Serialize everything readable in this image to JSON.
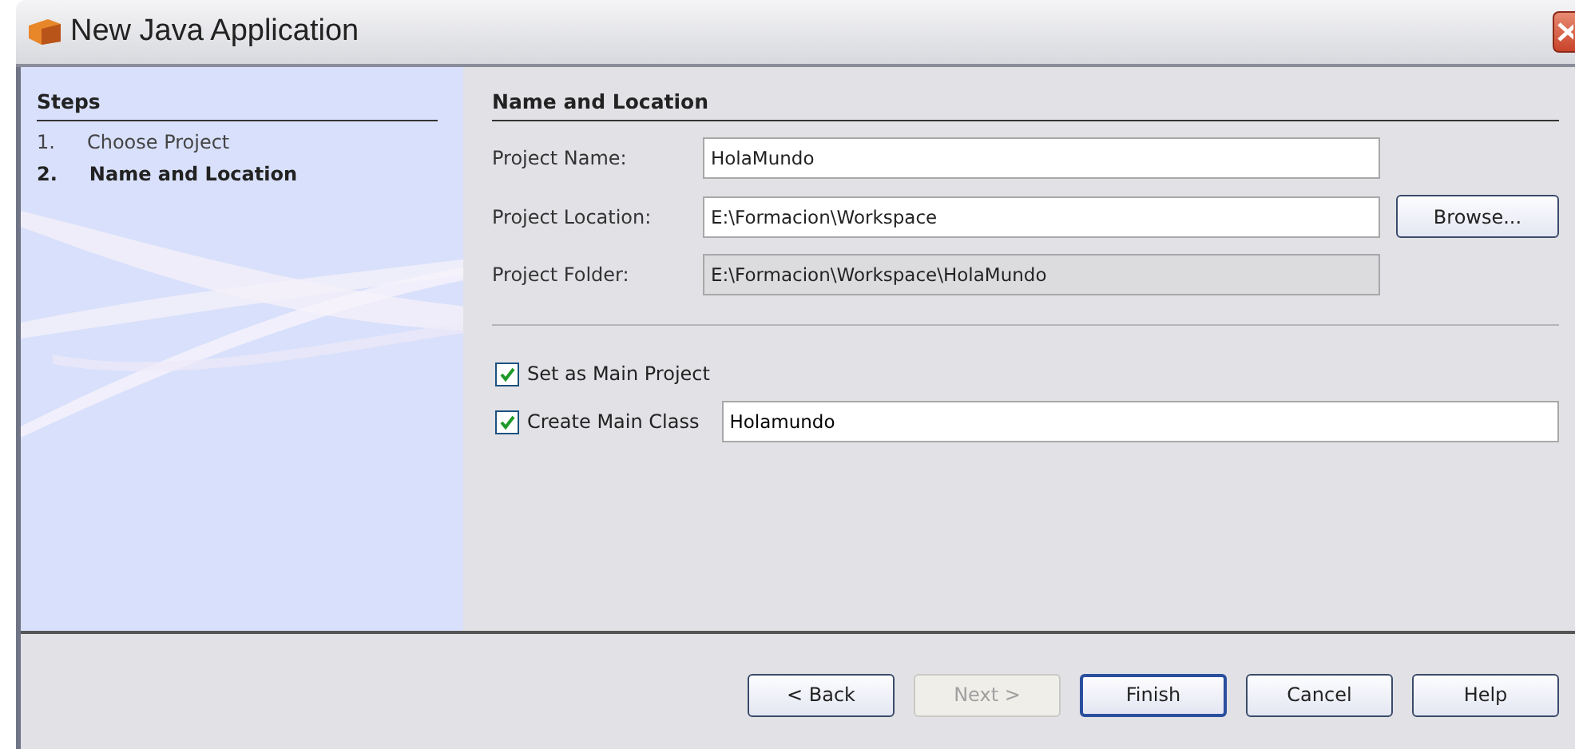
{
  "window": {
    "title": "New Java Application"
  },
  "steps": {
    "title": "Steps",
    "items": [
      {
        "number": "1.",
        "label": "Choose Project",
        "selected": false
      },
      {
        "number": "2.",
        "label": "Name and Location",
        "selected": true
      }
    ]
  },
  "panel": {
    "title": "Name and Location",
    "fields": [
      {
        "label": "Project Name:",
        "value": "HolaMundo",
        "disabled": false
      },
      {
        "label": "Project Location:",
        "value": "E:\\Formacion\\Workspace",
        "disabled": false,
        "button": "Browse..."
      },
      {
        "label": "Project Folder:",
        "value": "E:\\Formacion\\Workspace\\HolaMundo",
        "disabled": true
      }
    ],
    "options": [
      {
        "label": "Set as Main Project",
        "checked": true
      },
      {
        "label": "Create Main Class",
        "checked": true,
        "value": "Holamundo"
      }
    ]
  },
  "buttons": [
    {
      "label": "< Back",
      "disabled": false,
      "default": false
    },
    {
      "label": "Next >",
      "disabled": true,
      "default": false
    },
    {
      "label": "Finish",
      "disabled": false,
      "default": true
    },
    {
      "label": "Cancel",
      "disabled": false,
      "default": false
    },
    {
      "label": "Help",
      "disabled": false,
      "default": false
    }
  ]
}
